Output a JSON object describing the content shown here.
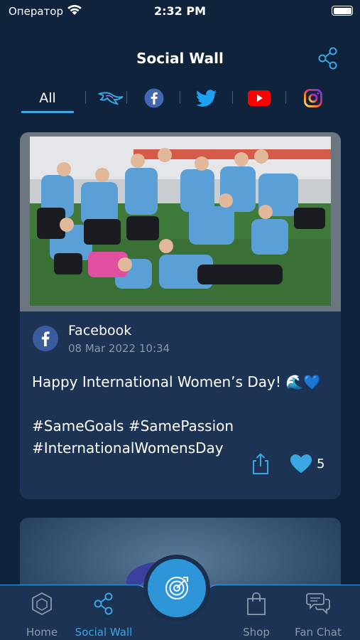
{
  "status_bar": {
    "carrier": "Оператор",
    "time": "2:32 PM"
  },
  "header": {
    "title": "Social Wall"
  },
  "filters": {
    "all_label": "All",
    "items": [
      {
        "icon": "team-logo-icon"
      },
      {
        "icon": "facebook-icon"
      },
      {
        "icon": "twitter-icon"
      },
      {
        "icon": "youtube-icon"
      },
      {
        "icon": "instagram-icon"
      }
    ]
  },
  "post": {
    "source": "Facebook",
    "date": "08 Mar 2022 10:34",
    "text": "Happy International Women’s Day! 🌊💙\n\n#SameGoals #SamePassion\n#InternationalWomensDay",
    "likes": "5"
  },
  "nav": {
    "items": [
      {
        "label": "Home",
        "icon": "home-icon"
      },
      {
        "label": "Social Wall",
        "icon": "share-icon"
      },
      {
        "label": "",
        "icon": "target-icon"
      },
      {
        "label": "Shop",
        "icon": "shopping-bag-icon"
      },
      {
        "label": "Fan Chat",
        "icon": "chat-bubbles-icon"
      }
    ]
  },
  "colors": {
    "background": "#10233d",
    "card": "#1c3353",
    "accent": "#3aa7e2",
    "muted": "#8d9aab"
  }
}
